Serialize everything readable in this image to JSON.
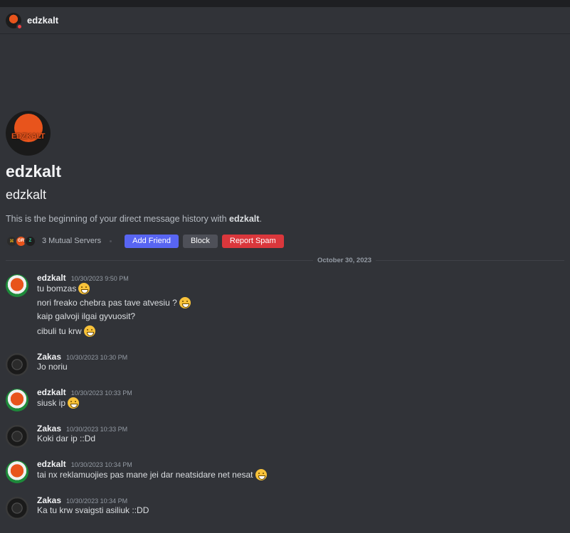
{
  "header": {
    "name": "edzkalt"
  },
  "profile": {
    "avatar_text": "EDZKALT",
    "display_name": "edzkalt",
    "username": "edzkalt",
    "intro_prefix": "This is the beginning of your direct message history with ",
    "intro_name": "edzkalt",
    "intro_suffix": ".",
    "mutual_servers": "3 Mutual Servers",
    "servers": [
      "server-1",
      "server-2",
      "server-3"
    ],
    "server_icon_labels": [
      "",
      "GR",
      "Z"
    ],
    "add_friend": "Add Friend",
    "block": "Block",
    "report_spam": "Report Spam"
  },
  "divider": {
    "date": "October 30, 2023"
  },
  "messages": [
    {
      "author": "edzkalt",
      "timestamp": "10/30/2023 9:50 PM",
      "avatar": "edzkalt",
      "lines": [
        {
          "text": "tu bomzas",
          "emoji": "grinning-face"
        },
        {
          "text": "nori freako chebra pas tave atvesiu ?",
          "emoji": "grinning-face"
        },
        {
          "text": "kaip galvoji ilgai gyvuosit?",
          "emoji": ""
        },
        {
          "text": "cibuli tu krw",
          "emoji": "grinning-face"
        }
      ]
    },
    {
      "author": "Zakas",
      "timestamp": "10/30/2023 10:30 PM",
      "avatar": "zakas",
      "lines": [
        {
          "text": "Jo noriu",
          "emoji": ""
        }
      ]
    },
    {
      "author": "edzkalt",
      "timestamp": "10/30/2023 10:33 PM",
      "avatar": "edzkalt",
      "lines": [
        {
          "text": "siusk ip",
          "emoji": "grinning-face"
        }
      ]
    },
    {
      "author": "Zakas",
      "timestamp": "10/30/2023 10:33 PM",
      "avatar": "zakas",
      "lines": [
        {
          "text": "Koki dar ip ::Dd",
          "emoji": ""
        }
      ]
    },
    {
      "author": "edzkalt",
      "timestamp": "10/30/2023 10:34 PM",
      "avatar": "edzkalt",
      "lines": [
        {
          "text": "tai nx reklamuojies pas mane jei dar neatsidare net nesat",
          "emoji": "grinning-face"
        }
      ]
    },
    {
      "author": "Zakas",
      "timestamp": "10/30/2023 10:34 PM",
      "avatar": "zakas",
      "lines": [
        {
          "text": "Ka tu krw svaigsti asiliuk ::DD",
          "emoji": ""
        }
      ]
    }
  ],
  "colors": {
    "background": "#313338",
    "blurple": "#5865f2",
    "danger": "#da373c",
    "secondary": "#4e5058"
  }
}
